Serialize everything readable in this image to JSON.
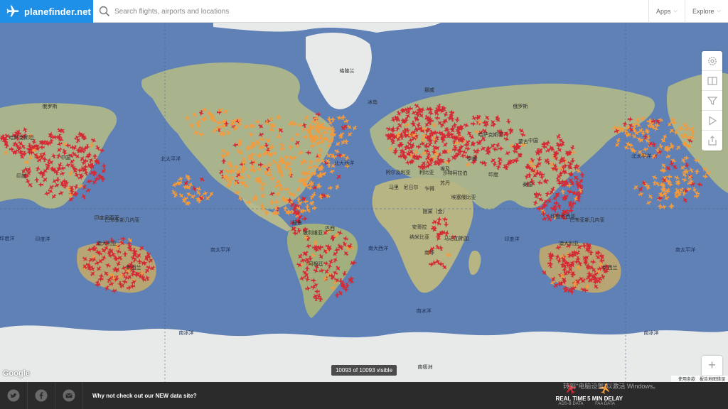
{
  "header": {
    "brand": "planefinder.net",
    "search_placeholder": "Search flights, airports and locations",
    "nav": [
      {
        "label": "Apps"
      },
      {
        "label": "Explore"
      }
    ]
  },
  "map": {
    "visible_count": "10093 of 10093 visible",
    "attribution": "Google",
    "terms": [
      "使用条款",
      "报告地图错误"
    ],
    "labels": {
      "greenland": "格陵兰",
      "iceland": "冰岛",
      "norway": "挪威",
      "russia_left": "俄罗斯",
      "russia_right": "俄罗斯",
      "kazakhstan_left": "哈萨克斯坦",
      "kazakhstan_right": "哈萨克斯坦",
      "china_left": "中国",
      "china_right": "中国",
      "india_left": "印度",
      "india_right": "印度",
      "north_pacific_left": "北太平洋",
      "north_pacific_right": "北太平洋",
      "north_atlantic": "北大西洋",
      "south_pacific_left": "南太平洋",
      "south_pacific_right": "南太平洋",
      "south_atlantic": "南大西洋",
      "indian_ocean_left": "印度洋",
      "indian_ocean_right": "印度洋",
      "indian_ocean_edge": "印度洋",
      "southern_ocean_left": "南冰洋",
      "southern_ocean_mid": "南冰洋",
      "southern_ocean_right": "南冰洋",
      "antarctica": "南极洲",
      "australia_left": "澳大利亚",
      "australia_right": "澳大利亚",
      "new_zealand_left": "新西兰",
      "new_zealand_right": "新西兰",
      "indonesia_left": "印度尼西亚",
      "indonesia_right": "印度尼西亚",
      "png_left": "巴布亚新几内亚",
      "png_right": "巴布亚新几内亚",
      "brazil": "巴西",
      "peru": "秘鲁",
      "bolivia": "玻利维亚",
      "argentina": "阿根廷",
      "algeria": "阿尔及利亚",
      "libya": "利比亚",
      "egypt": "埃及",
      "mali": "马里",
      "niger": "尼日尔",
      "sudan": "苏丹",
      "chad": "乍得",
      "ethiopia": "埃塞俄比亚",
      "drc": "刚果（金）",
      "angola": "安哥拉",
      "namibia": "纳米比亚",
      "south_africa": "南非",
      "madagascar": "马达加斯加",
      "iran": "伊朗",
      "saudi": "沙特阿拉伯",
      "thailand": "泰国",
      "mongolia": "蒙古"
    }
  },
  "toolbar": {
    "tools": [
      {
        "icon": "gear-icon"
      },
      {
        "icon": "book-icon"
      },
      {
        "icon": "filter-icon"
      },
      {
        "icon": "play-icon"
      },
      {
        "icon": "share-icon"
      }
    ],
    "zoom_in": "+",
    "zoom_out": "−"
  },
  "footer": {
    "social": [
      {
        "icon": "twitter-icon"
      },
      {
        "icon": "facebook-icon"
      },
      {
        "icon": "email-icon"
      }
    ],
    "promo": "Why not check out our NEW data site?",
    "legend": [
      {
        "title": "REAL TIME",
        "subtitle": "ADS-B DATA",
        "color": "#d42a35"
      },
      {
        "title": "5 MIN DELAY",
        "subtitle": "FAA DATA",
        "color": "#f39a3d"
      }
    ],
    "watermark": "转到\"电脑设置\"以激活 Windows。"
  },
  "colors": {
    "brand": "#1e90e8",
    "ocean": "#5f81b5",
    "land": "#a9b48e",
    "ice": "#e8eaea",
    "realtime": "#d42a35",
    "delayed": "#f39a3d"
  }
}
